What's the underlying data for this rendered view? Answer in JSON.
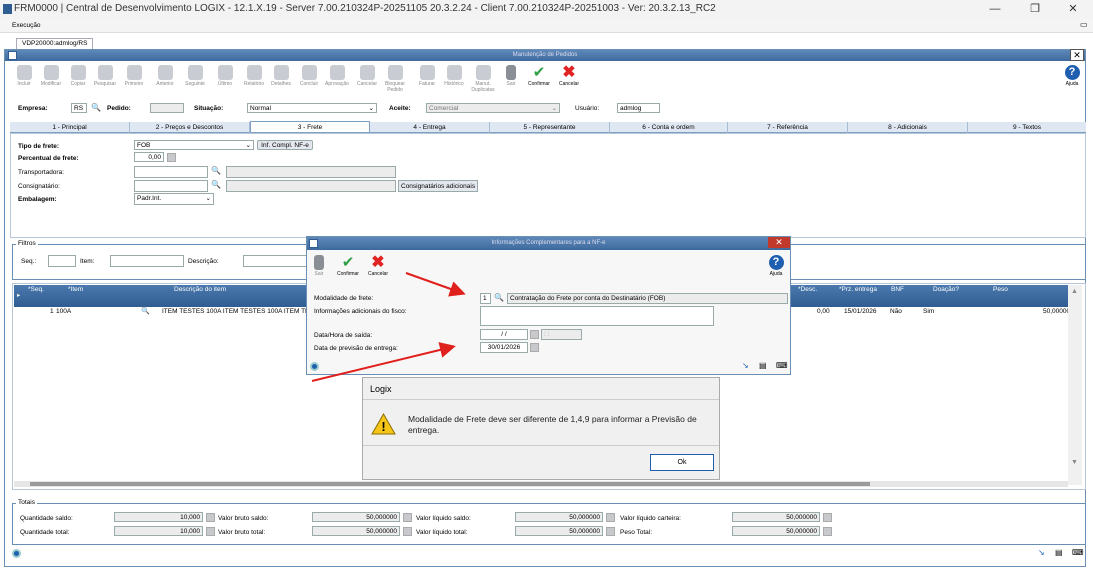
{
  "window": {
    "title": "FRM0000 | Central de Desenvolvimento LOGIX  -  12.1.X.19 - Server 7.00.210324P-20251105 20.3.2.24 - Client 7.00.210324P-20251003 - Ver: 20.3.2.13_RC2"
  },
  "menu": {
    "execucao": "Execução"
  },
  "doc_tab": "VDP20000:admlog/RS",
  "form": {
    "title": "Manutenção de Pedidos",
    "toolbar": [
      "Incluir",
      "Modificar",
      "Copiar",
      "Pesquisar",
      "Primeiro",
      "Anterior",
      "Seguinte",
      "Último",
      "Relatório",
      "Detalhes",
      "Concluir",
      "Aprovação",
      "Cancelar",
      "Bloquear Pedido",
      "Faturar",
      "Histórico",
      "Manut. Duplicatas",
      "Sair",
      "Confirmar",
      "Cancelar"
    ],
    "ajuda": "Ajuda",
    "empresa_label": "Empresa:",
    "empresa": "RS",
    "pedido_label": "Pedido:",
    "pedido": "",
    "situacao_label": "Situação:",
    "situacao": "Normal",
    "aceite_label": "Aceite:",
    "aceite": "Comercial",
    "usuario_label": "Usuário:",
    "usuario": "admlog"
  },
  "tabs": [
    "1 - Principal",
    "2 - Preços e Descontos",
    "3 - Frete",
    "4 - Entrega",
    "5 - Representante",
    "6 - Conta e ordem",
    "7 - Referência",
    "8 - Adicionais",
    "9 - Textos"
  ],
  "frete": {
    "tipo_label": "Tipo de frete:",
    "tipo": "FOB",
    "inf_btn": "Inf. Compl. NF-e",
    "percentual_label": "Percentual de frete:",
    "percentual": "0,00",
    "transportadora_label": "Transportadora:",
    "consignatario_label": "Consignatário:",
    "consig_btn": "Consignatários adicionais",
    "embalagem_label": "Embalagem:",
    "embalagem": "Padr.Int."
  },
  "filtros": {
    "title": "Filtros",
    "seq_label": "Seq.:",
    "item_label": "Item:",
    "desc_label": "Descrição:"
  },
  "grid": {
    "headers": {
      "seq": "*Seq.",
      "item": "*Item",
      "desc": "Descrição do item",
      "desc2": "*Desc.",
      "prz": "*Prz. entrega",
      "bnf": "BNF",
      "doacao": "Doação?",
      "peso": "Peso"
    },
    "row": {
      "seq": "1",
      "item": "100A",
      "desc": "ITEM TESTES 100A ITEM TESTES 100A ITEM TESTES",
      "desc_pct": "0,00",
      "prz": "15/01/2026",
      "bnf": "Não",
      "doacao": "Sim",
      "peso": "50,00000"
    }
  },
  "totais": {
    "title": "Totais",
    "qtd_saldo_label": "Quantidade saldo:",
    "qtd_saldo": "10,000",
    "bruto_saldo_label": "Valor bruto saldo:",
    "bruto_saldo": "50,000000",
    "liquido_saldo_label": "Valor líquido saldo:",
    "liquido_saldo": "50,000000",
    "liquido_carteira_label": "Valor líquido carteira:",
    "liquido_carteira": "50,000000",
    "qtd_total_label": "Quantidade total:",
    "qtd_total": "10,000",
    "bruto_total_label": "Valor bruto total:",
    "bruto_total": "50,000000",
    "liquido_total_label": "Valor líquido total:",
    "liquido_total": "50,000000",
    "peso_total_label": "Peso Total:",
    "peso_total": "50,000000"
  },
  "dialog": {
    "title": "Informações Complementares para a NF-e",
    "sair": "Sair",
    "confirmar": "Confirmar",
    "cancelar": "Cancelar",
    "ajuda": "Ajuda",
    "modalidade_label": "Modalidade de frete:",
    "modalidade": "1",
    "modalidade_desc": "Contratação do Frete por conta do Destinatário (FOB)",
    "info_label": "Informações adicionais do fisco:",
    "saida_label": "Data/Hora de saída:",
    "saida_data": "/  /",
    "saida_hora": ":  :",
    "previsao_label": "Data de previsão de entrega:",
    "previsao": "30/01/2026"
  },
  "message": {
    "title": "Logix",
    "text": "Modalidade de Frete deve ser diferente de 1,4,9 para informar a Previsão de entrega.",
    "ok": "Ok"
  },
  "colors": {
    "header_blue": "#3d6a9e",
    "arrow_red": "#e0201c",
    "confirm_green": "#2ea043",
    "cancel_red": "#e02424"
  }
}
